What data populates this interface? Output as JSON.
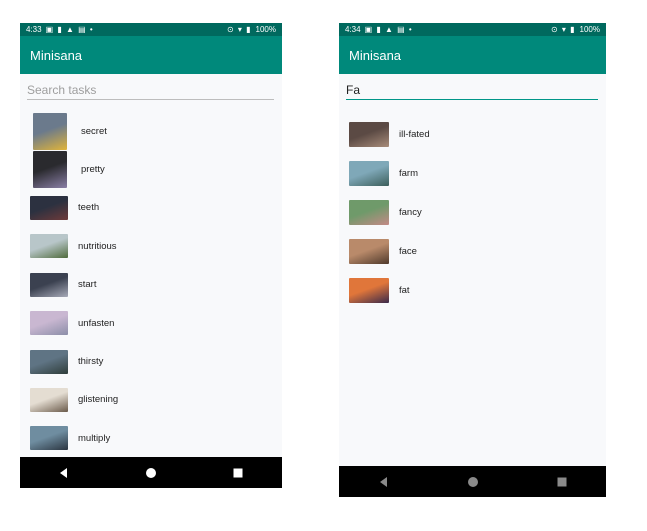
{
  "left_screen": {
    "status": {
      "time": "4:33",
      "icons": "▣ ▮ ▲ ▤ •",
      "right_icons": "⊙ ▾ ▮",
      "battery": "100%"
    },
    "app_title": "Minisana",
    "search": {
      "value": "",
      "placeholder": "Search tasks"
    },
    "items": [
      {
        "label": "secret",
        "icon": "cat-photo-thumbnail",
        "colors": [
          "#6b7a8c",
          "#e0b43a"
        ]
      },
      {
        "label": "pretty",
        "icon": "dark-portrait-thumbnail",
        "colors": [
          "#2a2a2e",
          "#8a7fa6"
        ]
      },
      {
        "label": "teeth",
        "icon": "dusk-landscape-thumbnail",
        "colors": [
          "#2c3140",
          "#6e3a3a"
        ]
      },
      {
        "label": "nutritious",
        "icon": "green-hills-thumbnail",
        "colors": [
          "#b8c6c9",
          "#4f6b3c"
        ]
      },
      {
        "label": "start",
        "icon": "deer-thumbnail",
        "colors": [
          "#3b4150",
          "#a7aab8"
        ]
      },
      {
        "label": "unfasten",
        "icon": "pink-clouds-thumbnail",
        "colors": [
          "#c9b7d1",
          "#8c8ea8"
        ]
      },
      {
        "label": "thirsty",
        "icon": "mountain-lake-thumbnail",
        "colors": [
          "#5f7484",
          "#2f3d3a"
        ]
      },
      {
        "label": "glistening",
        "icon": "snowy-village-thumbnail",
        "colors": [
          "#e4ddd2",
          "#6a5a4a"
        ]
      },
      {
        "label": "multiply",
        "icon": "fjord-thumbnail",
        "colors": [
          "#6f8da0",
          "#2b3540"
        ]
      }
    ]
  },
  "right_screen": {
    "status": {
      "time": "4:34",
      "icons": "▣ ▮ ▲ ▤ •",
      "right_icons": "⊙ ▾ ▮",
      "battery": "100%"
    },
    "app_title": "Minisana",
    "search": {
      "value": "Fa",
      "placeholder": "Search tasks"
    },
    "items": [
      {
        "label": "ill-fated",
        "icon": "old-town-thumbnail",
        "colors": [
          "#5b4a44",
          "#a88c7a"
        ]
      },
      {
        "label": "farm",
        "icon": "lake-thumbnail",
        "colors": [
          "#7fa8b8",
          "#3d5f5b"
        ]
      },
      {
        "label": "fancy",
        "icon": "cactus-plants-thumbnail",
        "colors": [
          "#6f9a6a",
          "#c48a86"
        ]
      },
      {
        "label": "face",
        "icon": "hands-food-thumbnail",
        "colors": [
          "#b98a6a",
          "#4f3a2c"
        ]
      },
      {
        "label": "fat",
        "icon": "sunset-city-thumbnail",
        "colors": [
          "#e0763a",
          "#3a2a4a"
        ]
      }
    ]
  },
  "navbar": {
    "back": "◀",
    "home": "●",
    "recents": "■"
  }
}
